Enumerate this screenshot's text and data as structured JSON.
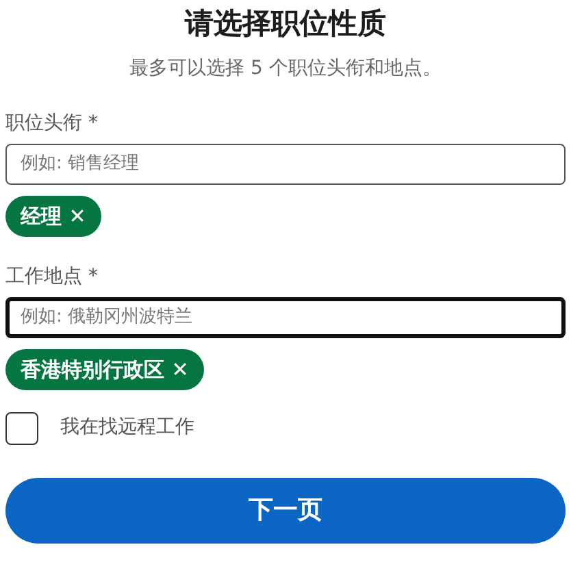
{
  "title": "请选择职位性质",
  "subtitle": "最多可以选择 5 个职位头衔和地点。",
  "fields": [
    {
      "label": "职位头衔 *",
      "placeholder": "例如: 销售经理",
      "focused": false,
      "chips": [
        {
          "label": "经理",
          "remove": "✕"
        }
      ]
    },
    {
      "label": "工作地点 *",
      "placeholder": "例如: 俄勒冈州波特兰",
      "focused": true,
      "chips": [
        {
          "label": "香港特别行政区",
          "remove": "✕"
        }
      ]
    }
  ],
  "remote": {
    "label": "我在找远程工作",
    "checked": false
  },
  "next_button": "下一页"
}
